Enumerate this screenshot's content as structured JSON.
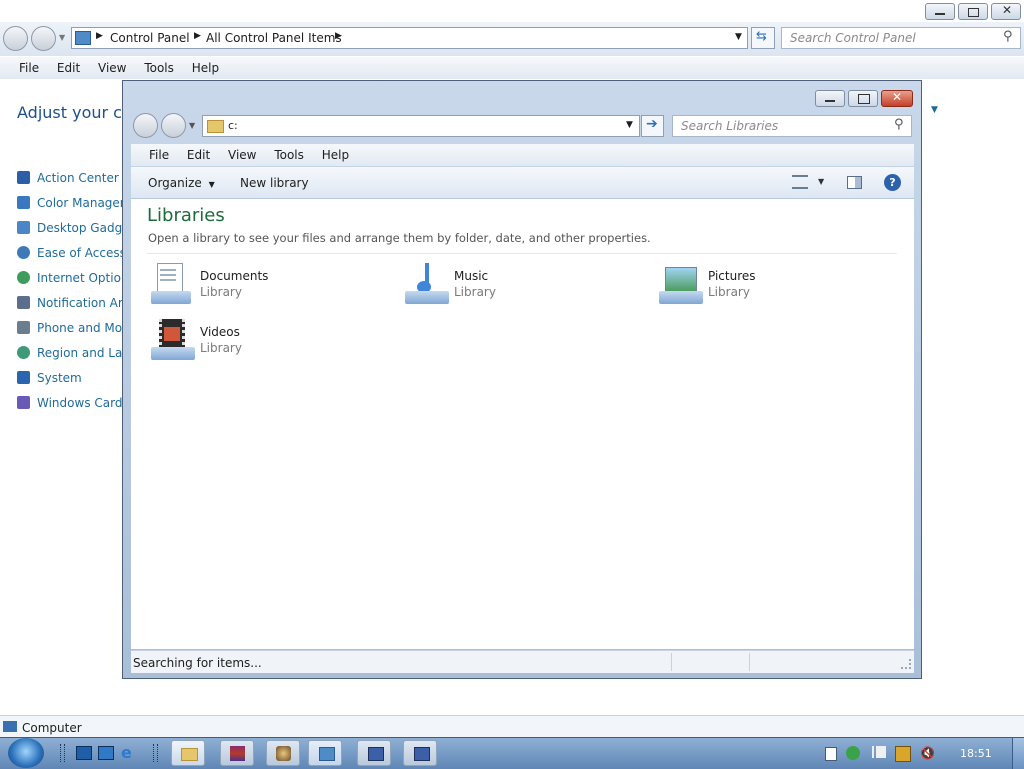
{
  "back_window": {
    "breadcrumb": [
      "Control Panel",
      "All Control Panel Items"
    ],
    "search_placeholder": "Search Control Panel",
    "menu": [
      "File",
      "Edit",
      "View",
      "Tools",
      "Help"
    ],
    "heading": "Adjust your con",
    "items": [
      {
        "label": "Action Center",
        "icon": "flag-icon"
      },
      {
        "label": "Color Managem",
        "icon": "monitor-icon"
      },
      {
        "label": "Desktop Gadget",
        "icon": "gadget-icon"
      },
      {
        "label": "Ease of Access C",
        "icon": "ease-icon"
      },
      {
        "label": "Internet Options",
        "icon": "globe-icon"
      },
      {
        "label": "Notification Are",
        "icon": "notify-icon"
      },
      {
        "label": "Phone and Mod",
        "icon": "phone-icon"
      },
      {
        "label": "Region and Lang",
        "icon": "region-icon"
      },
      {
        "label": "System",
        "icon": "system-icon"
      },
      {
        "label": "Windows CardSp",
        "icon": "cardspace-icon"
      }
    ]
  },
  "front_window": {
    "address": "c:",
    "search_placeholder": "Search Libraries",
    "menu": [
      "File",
      "Edit",
      "View",
      "Tools",
      "Help"
    ],
    "toolbar": {
      "organize": "Organize",
      "new_library": "New library"
    },
    "title": "Libraries",
    "subtitle": "Open a library to see your files and arrange them by folder, date, and other properties.",
    "libraries": [
      {
        "name": "Documents",
        "type": "Library"
      },
      {
        "name": "Music",
        "type": "Library"
      },
      {
        "name": "Pictures",
        "type": "Library"
      },
      {
        "name": "Videos",
        "type": "Library"
      }
    ],
    "status": "Searching for items..."
  },
  "statusbar": {
    "label": "Computer"
  },
  "taskbar": {
    "clock": "18:51"
  }
}
